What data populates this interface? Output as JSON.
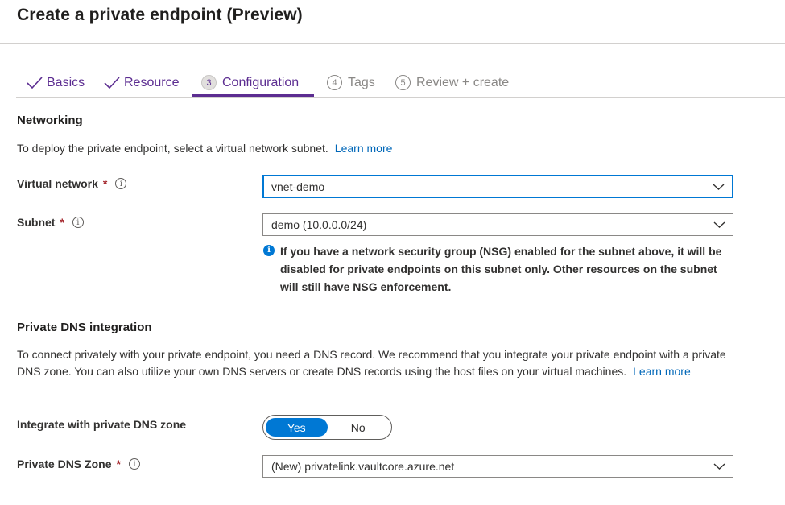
{
  "page": {
    "title": "Create a private endpoint (Preview)"
  },
  "tabs": [
    {
      "label": "Basics",
      "state": "done"
    },
    {
      "label": "Resource",
      "state": "done"
    },
    {
      "label": "Configuration",
      "number": "3",
      "state": "active"
    },
    {
      "label": "Tags",
      "number": "4",
      "state": "future"
    },
    {
      "label": "Review + create",
      "number": "5",
      "state": "future"
    }
  ],
  "networking": {
    "heading": "Networking",
    "description": "To deploy the private endpoint, select a virtual network subnet.",
    "learn_more": "Learn more",
    "virtual_network": {
      "label": "Virtual network",
      "required": "*",
      "value": "vnet-demo"
    },
    "subnet": {
      "label": "Subnet",
      "required": "*",
      "value": "demo (10.0.0.0/24)"
    },
    "nsg_note": "If you have a network security group (NSG) enabled for the subnet above, it will be disabled for private endpoints on this subnet only. Other resources on the subnet will still have NSG enforcement."
  },
  "dns": {
    "heading": "Private DNS integration",
    "description": "To connect privately with your private endpoint, you need a DNS record. We recommend that you integrate your private endpoint with a private DNS zone. You can also utilize your own DNS servers or create DNS records using the host files on your virtual machines.",
    "learn_more": "Learn more",
    "integrate": {
      "label": "Integrate with private DNS zone",
      "yes": "Yes",
      "no": "No",
      "selected": "Yes"
    },
    "zone": {
      "label": "Private DNS Zone",
      "required": "*",
      "value": "(New) privatelink.vaultcore.azure.net"
    }
  },
  "icons": {
    "info": "info-icon",
    "check": "checkmark-icon",
    "chevron": "chevron-down-icon"
  },
  "colors": {
    "accent": "#5c2d91",
    "primary": "#0078d4",
    "link": "#0067b8",
    "required": "#a4262c"
  }
}
